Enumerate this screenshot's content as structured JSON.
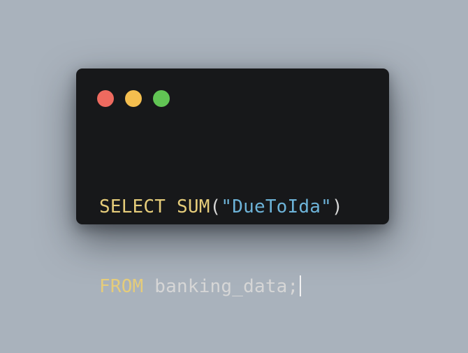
{
  "window": {
    "traffic_lights": [
      {
        "name": "close",
        "color": "#ee6a5f"
      },
      {
        "name": "minimize",
        "color": "#f4be4f"
      },
      {
        "name": "maximize",
        "color": "#61c454"
      }
    ]
  },
  "code": {
    "line1": {
      "keyword_select": "SELECT",
      "space": " ",
      "function": "SUM",
      "paren_open": "(",
      "string": "\"DueToIda\"",
      "paren_close": ")"
    },
    "line2": {
      "keyword_from": "FROM",
      "space": " ",
      "table": "banking_data;"
    }
  }
}
